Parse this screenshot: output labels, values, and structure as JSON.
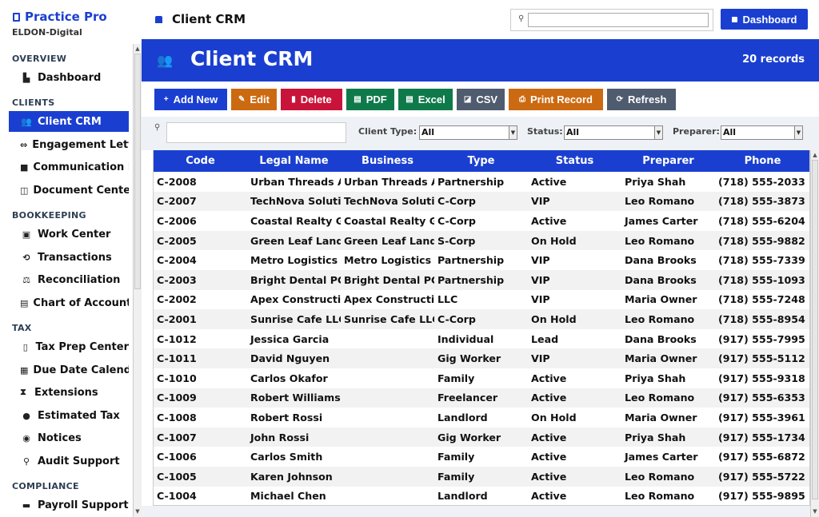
{
  "app": {
    "name": "Practice Pro",
    "org": "ELDON-Digital"
  },
  "sidebar": {
    "sections": [
      {
        "title": "OVERVIEW",
        "items": [
          {
            "label": "Dashboard",
            "icon": "chart-bar-icon"
          }
        ]
      },
      {
        "title": "CLIENTS",
        "items": [
          {
            "label": "Client CRM",
            "icon": "users-icon",
            "active": true
          },
          {
            "label": "Engagement Letters",
            "icon": "handshake-icon"
          },
          {
            "label": "Communication Log",
            "icon": "message-icon"
          },
          {
            "label": "Document Center",
            "icon": "folder-icon"
          }
        ]
      },
      {
        "title": "BOOKKEEPING",
        "items": [
          {
            "label": "Work Center",
            "icon": "briefcase-icon"
          },
          {
            "label": "Transactions",
            "icon": "exchange-icon"
          },
          {
            "label": "Reconciliation",
            "icon": "scale-icon"
          },
          {
            "label": "Chart of Accounts",
            "icon": "book-icon"
          }
        ]
      },
      {
        "title": "TAX",
        "items": [
          {
            "label": "Tax Prep Center",
            "icon": "clipboard-icon"
          },
          {
            "label": "Due Date Calendar",
            "icon": "calendar-icon"
          },
          {
            "label": "Extensions",
            "icon": "hourglass-icon"
          },
          {
            "label": "Estimated Tax",
            "icon": "money-bag-icon"
          },
          {
            "label": "Notices",
            "icon": "bell-icon"
          },
          {
            "label": "Audit Support",
            "icon": "magnifier-icon"
          }
        ]
      },
      {
        "title": "COMPLIANCE",
        "items": [
          {
            "label": "Payroll Support",
            "icon": "wallet-icon"
          }
        ]
      }
    ]
  },
  "topbar": {
    "title": "Client CRM",
    "search_placeholder": "",
    "dashboard_label": "Dashboard"
  },
  "header": {
    "title": "Client CRM",
    "records": "20 records"
  },
  "toolbar": {
    "buttons": [
      {
        "label": "Add New",
        "icon": "plus-icon",
        "color": "#1a3fd0"
      },
      {
        "label": "Edit",
        "icon": "pencil-icon",
        "color": "#cc6a12"
      },
      {
        "label": "Delete",
        "icon": "trash-icon",
        "color": "#c8143a"
      },
      {
        "label": "PDF",
        "icon": "pdf-icon",
        "color": "#0e7a4a"
      },
      {
        "label": "Excel",
        "icon": "excel-icon",
        "color": "#0e7a4a"
      },
      {
        "label": "CSV",
        "icon": "csv-icon",
        "color": "#4f5b6e"
      },
      {
        "label": "Print Record",
        "icon": "print-icon",
        "color": "#cc6a12"
      },
      {
        "label": "Refresh",
        "icon": "refresh-icon",
        "color": "#4f5b6e"
      }
    ]
  },
  "filters": {
    "search_value": "",
    "client_type_label": "Client Type:",
    "client_type_value": "All",
    "status_label": "Status:",
    "status_value": "All",
    "preparer_label": "Preparer:",
    "preparer_value": "All"
  },
  "table": {
    "columns": [
      "Code",
      "Legal Name",
      "Business",
      "Type",
      "Status",
      "Preparer",
      "Phone"
    ],
    "rows": [
      [
        "C-2008",
        "Urban Threads Apparel",
        "Urban Threads Apparel",
        "Partnership",
        "Active",
        "Priya Shah",
        "(718) 555-2033"
      ],
      [
        "C-2007",
        "TechNova Solutions",
        "TechNova Solutions",
        "C-Corp",
        "VIP",
        "Leo Romano",
        "(718) 555-3873"
      ],
      [
        "C-2006",
        "Coastal Realty Group",
        "Coastal Realty Group",
        "C-Corp",
        "Active",
        "James Carter",
        "(718) 555-6204"
      ],
      [
        "C-2005",
        "Green Leaf Landscaping",
        "Green Leaf Landscaping",
        "S-Corp",
        "On Hold",
        "Leo Romano",
        "(718) 555-9882"
      ],
      [
        "C-2004",
        "Metro Logistics LLC",
        "Metro Logistics LLC",
        "Partnership",
        "VIP",
        "Dana Brooks",
        "(718) 555-7339"
      ],
      [
        "C-2003",
        "Bright Dental PC",
        "Bright Dental PC",
        "Partnership",
        "VIP",
        "Dana Brooks",
        "(718) 555-1093"
      ],
      [
        "C-2002",
        "Apex Construction",
        "Apex Construction",
        "LLC",
        "VIP",
        "Maria Owner",
        "(718) 555-7248"
      ],
      [
        "C-2001",
        "Sunrise Cafe LLC",
        "Sunrise Cafe LLC",
        "C-Corp",
        "On Hold",
        "Leo Romano",
        "(718) 555-8954"
      ],
      [
        "C-1012",
        "Jessica Garcia",
        "",
        "Individual",
        "Lead",
        "Dana Brooks",
        "(917) 555-7995"
      ],
      [
        "C-1011",
        "David Nguyen",
        "",
        "Gig Worker",
        "VIP",
        "Maria Owner",
        "(917) 555-5112"
      ],
      [
        "C-1010",
        "Carlos Okafor",
        "",
        "Family",
        "Active",
        "Priya Shah",
        "(917) 555-9318"
      ],
      [
        "C-1009",
        "Robert Williams",
        "",
        "Freelancer",
        "Active",
        "Leo Romano",
        "(917) 555-6353"
      ],
      [
        "C-1008",
        "Robert Rossi",
        "",
        "Landlord",
        "On Hold",
        "Maria Owner",
        "(917) 555-3961"
      ],
      [
        "C-1007",
        "John Rossi",
        "",
        "Gig Worker",
        "Active",
        "Priya Shah",
        "(917) 555-1734"
      ],
      [
        "C-1006",
        "Carlos Smith",
        "",
        "Family",
        "Active",
        "James Carter",
        "(917) 555-6872"
      ],
      [
        "C-1005",
        "Karen Johnson",
        "",
        "Family",
        "Active",
        "Leo Romano",
        "(917) 555-5722"
      ],
      [
        "C-1004",
        "Michael Chen",
        "",
        "Landlord",
        "Active",
        "Leo Romano",
        "(917) 555-9895"
      ]
    ]
  }
}
